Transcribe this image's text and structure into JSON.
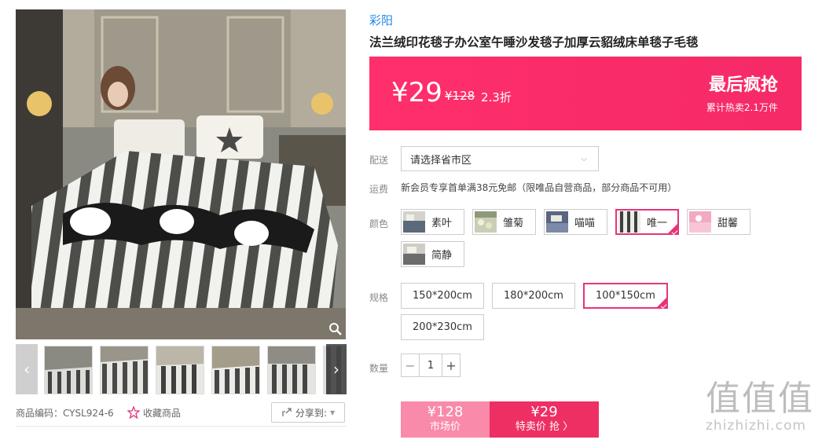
{
  "gallery": {
    "thumb_count": 6,
    "prev_icon": "chevron-left-icon",
    "next_icon": "chevron-right-icon"
  },
  "meta": {
    "product_code": "商品编码：CYSL924-6",
    "favorite_label": "收藏商品",
    "share_label": "分享到:"
  },
  "product": {
    "brand": "彩阳",
    "title": "法兰绒印花毯子办公室午睡沙发毯子加厚云貂绒床单毯子毛毯"
  },
  "price": {
    "current": "¥29",
    "original": "¥128",
    "discount": "2.3折",
    "flash_label": "最后疯抢",
    "sold_text": "累计热卖2.1万件",
    "bg_color": "#ff2f6b"
  },
  "delivery": {
    "label": "配送",
    "placeholder": "请选择省市区"
  },
  "shipping": {
    "label": "运费",
    "text": "新会员专享首单满38元免邮（限唯品自营商品，部分商品不可用）"
  },
  "colors": {
    "label": "颜色",
    "options": [
      {
        "name": "素叶",
        "selected": false
      },
      {
        "name": "雏菊",
        "selected": false
      },
      {
        "name": "喵喵",
        "selected": false
      },
      {
        "name": "唯一",
        "selected": true
      },
      {
        "name": "甜馨",
        "selected": false
      },
      {
        "name": "简静",
        "selected": false
      }
    ]
  },
  "sizes": {
    "label": "规格",
    "options": [
      {
        "name": "150*200cm",
        "selected": false
      },
      {
        "name": "180*200cm",
        "selected": false
      },
      {
        "name": "100*150cm",
        "selected": true
      },
      {
        "name": "200*230cm",
        "selected": false
      }
    ]
  },
  "quantity": {
    "label": "数量",
    "value": "1",
    "minus": "−",
    "plus": "+"
  },
  "buy": {
    "market_price": "¥128",
    "market_label": "市场价",
    "special_price": "¥29",
    "special_label": "特卖价 抢 〉"
  },
  "watermark": {
    "logo": "值值值",
    "url": "zhizhizhi.com"
  }
}
